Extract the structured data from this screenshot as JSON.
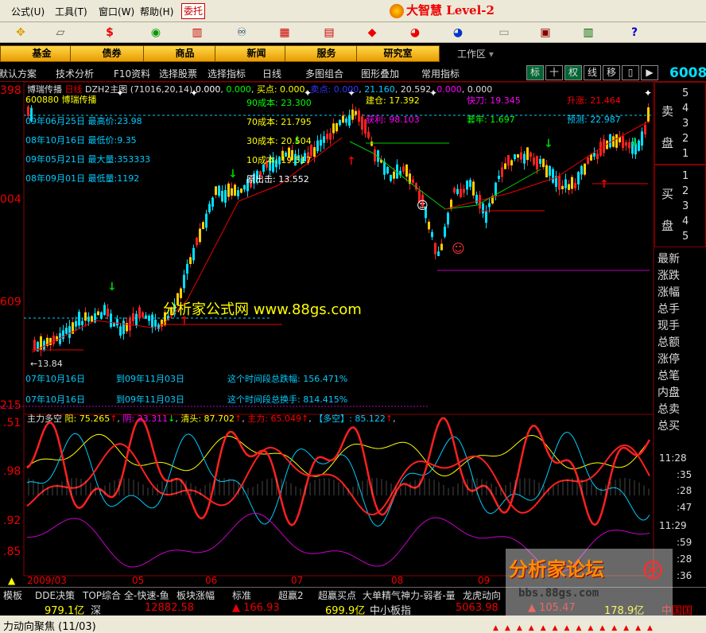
{
  "menu": {
    "items": [
      "公式(U)",
      "工具(T)",
      "窗口(W)",
      "帮助(H)"
    ],
    "wei_tuo": "委托",
    "brand": "大智慧 Level-2"
  },
  "nav": {
    "buttons": [
      "基金",
      "债券",
      "商品",
      "新闻",
      "服务",
      "研究室"
    ],
    "work_area": "工作区"
  },
  "funcbar": {
    "items": [
      "默认方案",
      "技术分析",
      "F10资料",
      "选择股票",
      "选择指标",
      "日线",
      "多图组合",
      "图形叠加",
      "常用指标"
    ],
    "right_buttons": [
      "标",
      "十",
      "权",
      "线",
      "移"
    ],
    "code_right": "6008"
  },
  "chart": {
    "header": "博瑞传播",
    "header_period": "日线",
    "header_formula": "DZH2主图 (71016,20,14)",
    "header_values": [
      "0.000",
      "0.000",
      "买点: 0.000",
      "卖点: 0.000",
      "21.160",
      "20.592",
      "0.000",
      "0.000"
    ],
    "stock_line": "600880 博瑞传播",
    "info_lines": [
      "09年06月25日  最高价:23.98",
      "08年10月16日  最低价:9.35",
      "09年05月21日  最大量:353333",
      "08年09月01日  最低量:1192"
    ],
    "cost_lines": [
      "90成本: 23.300",
      "70成本: 21.795",
      "30成本: 20.504",
      "10成本: 19.517",
      "原出击: 13.552"
    ],
    "annotations": {
      "jiancang": "建仓: 17.392",
      "kuaidao": "快刀: 19.345",
      "shengzhang": "升涨: 21.464",
      "huoli": "获利: 98.103",
      "taolao": "套牢: 1.697",
      "yuce": "预测: 22.987",
      "low_mark": "13.84"
    },
    "period_lines": [
      {
        "from": "07年10月16日",
        "to": "到09年11月03日",
        "text": "这个时间段总跌幅: 156.471%"
      },
      {
        "from": "07年10月16日",
        "to": "到09年11月03日",
        "text": "这个时间段总换手: 814.415%"
      }
    ],
    "y_labels_main": [
      "398",
      "004",
      "609",
      "215"
    ],
    "watermark_mid": "分析家公式网 www.88gs.com",
    "osc_header": "主力多空",
    "osc_values": [
      "阳: 75.265",
      "阴: 23.311",
      "清头: 87.702",
      "主力: 65.049",
      "【多空】: 85.122"
    ],
    "y_labels_osc": [
      ".51",
      ".98",
      ".92",
      ".85"
    ],
    "x_labels": [
      "2009/03",
      "05",
      "06",
      "07",
      "08",
      "09"
    ],
    "chart_data": {
      "type": "candlestick",
      "price_axis": {
        "top": 23.98,
        "bottom": 9.35
      },
      "period": "日线"
    }
  },
  "rightpanel": {
    "sell": "卖盘",
    "buy": "买盘",
    "sell_nums": [
      "5",
      "4",
      "3",
      "2",
      "1"
    ],
    "buy_nums": [
      "1",
      "2",
      "3",
      "4",
      "5"
    ],
    "list": [
      "最新",
      "涨跌",
      "涨幅",
      "总手",
      "现手",
      "总额",
      "涨停",
      "总笔",
      "内盘",
      "总卖",
      "总买"
    ],
    "ticks": [
      "11:28",
      ":35",
      ":28",
      ":47",
      "11:29",
      ":59",
      ":28",
      ":36"
    ]
  },
  "tabs": [
    "模板",
    "DDE决策",
    "TOP综合",
    "全-快速-鱼",
    "板块涨幅",
    "标准",
    "超赢2",
    "超赢买点",
    "大单精气神力-弱者-量",
    "龙虎动向"
  ],
  "status": {
    "v1": "979.1亿",
    "sz": "深",
    "v2": "12882.58",
    "v3": "166.93",
    "v4": "699.9亿",
    "zxb": "中小板指",
    "v5": "5063.98",
    "v6": "105.47",
    "v7": "178.9亿",
    "zg": "中国国"
  },
  "bottom": {
    "text": "力动向聚焦 (11/03)"
  },
  "watermark": {
    "brand": "分析家论坛",
    "url": "bbs.88gs.com"
  },
  "colors": {
    "up": "#ff2020",
    "down": "#00e0ff",
    "accent": "#ffd84a"
  }
}
